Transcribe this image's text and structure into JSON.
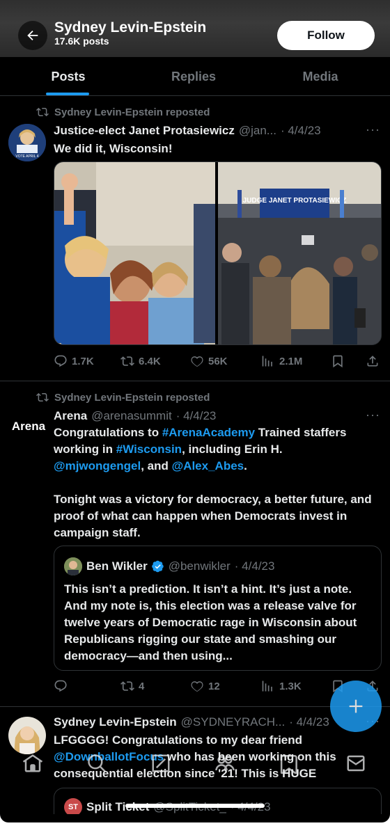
{
  "header": {
    "name": "Sydney Levin-Epstein",
    "post_count": "17.6K posts",
    "follow_label": "Follow"
  },
  "tabs": [
    {
      "label": "Posts",
      "active": true
    },
    {
      "label": "Replies",
      "active": false
    },
    {
      "label": "Media",
      "active": false
    }
  ],
  "posts": [
    {
      "repost_label": "Sydney Levin-Epstein reposted",
      "name": "Justice-elect Janet Protasiewicz",
      "handle": "@jan...",
      "date": "· 4/4/23",
      "more": "···",
      "avatar_caption": "VOTE APRIL 4",
      "text": "We did it, Wisconsin!",
      "media_sign": "JUDGE JANET PROTASIEWICZ",
      "replies": "1.7K",
      "reposts": "6.4K",
      "likes": "56K",
      "views": "2.1M"
    },
    {
      "repost_label": "Sydney Levin-Epstein reposted",
      "name": "Arena",
      "handle": "@arenasummit",
      "date": "· 4/4/23",
      "more": "···",
      "avatar_text": "Arena",
      "text_parts": {
        "p1": "Congratulations to ",
        "tag1": "#ArenaAcademy",
        "p2": " Trained staffers working in ",
        "tag2": "#Wisconsin",
        "p3": ", including Erin H. ",
        "mention1": "@mjwongengel",
        "p4": ", and ",
        "mention2": "@Alex_Abes",
        "p5": ".",
        "para2": "Tonight was a victory for democracy, a better future, and proof of what can happen when Democrats invest in campaign staff."
      },
      "quote": {
        "name": "Ben Wikler",
        "handle": "@benwikler",
        "date": "· 4/4/23",
        "text": "This isn’t a prediction. It isn’t a hint. It’s just a note. And my note is, this election was a release valve for twelve years of Democratic rage in Wisconsin about Republicans rigging our state and smashing our democracy—and then using..."
      },
      "reposts": "4",
      "likes": "12",
      "views": "1.3K"
    },
    {
      "name": "Sydney Levin-Epstein",
      "handle": "@SYDNEYRACH...",
      "date": "· 4/4/23",
      "more": "···",
      "text_parts": {
        "p1": "LFGGGG! Congratulations to my dear friend ",
        "mention1": "@DownballotFocus",
        "p2": " who has been working on this consequential election since '21! This is HUGE"
      },
      "quote": {
        "avatar_text": "ST",
        "name": "Split Ticket",
        "handle": "@SplitTicket_",
        "date": "· 4/4/23"
      }
    }
  ],
  "colors": {
    "accent": "#1d9bf0",
    "background": "#000000",
    "text": "#e7e9ea",
    "muted": "#71767b",
    "divider": "#2f3336"
  },
  "icons": {
    "back": "arrow-left-icon",
    "repost": "repost-icon",
    "reply": "reply-icon",
    "like": "heart-icon",
    "views": "views-icon",
    "bookmark": "bookmark-icon",
    "share": "share-icon",
    "verified": "verified-badge-icon",
    "compose": "plus-icon",
    "nav": [
      "home-icon",
      "search-icon",
      "grok-icon",
      "communities-icon",
      "notifications-icon",
      "messages-icon"
    ]
  }
}
